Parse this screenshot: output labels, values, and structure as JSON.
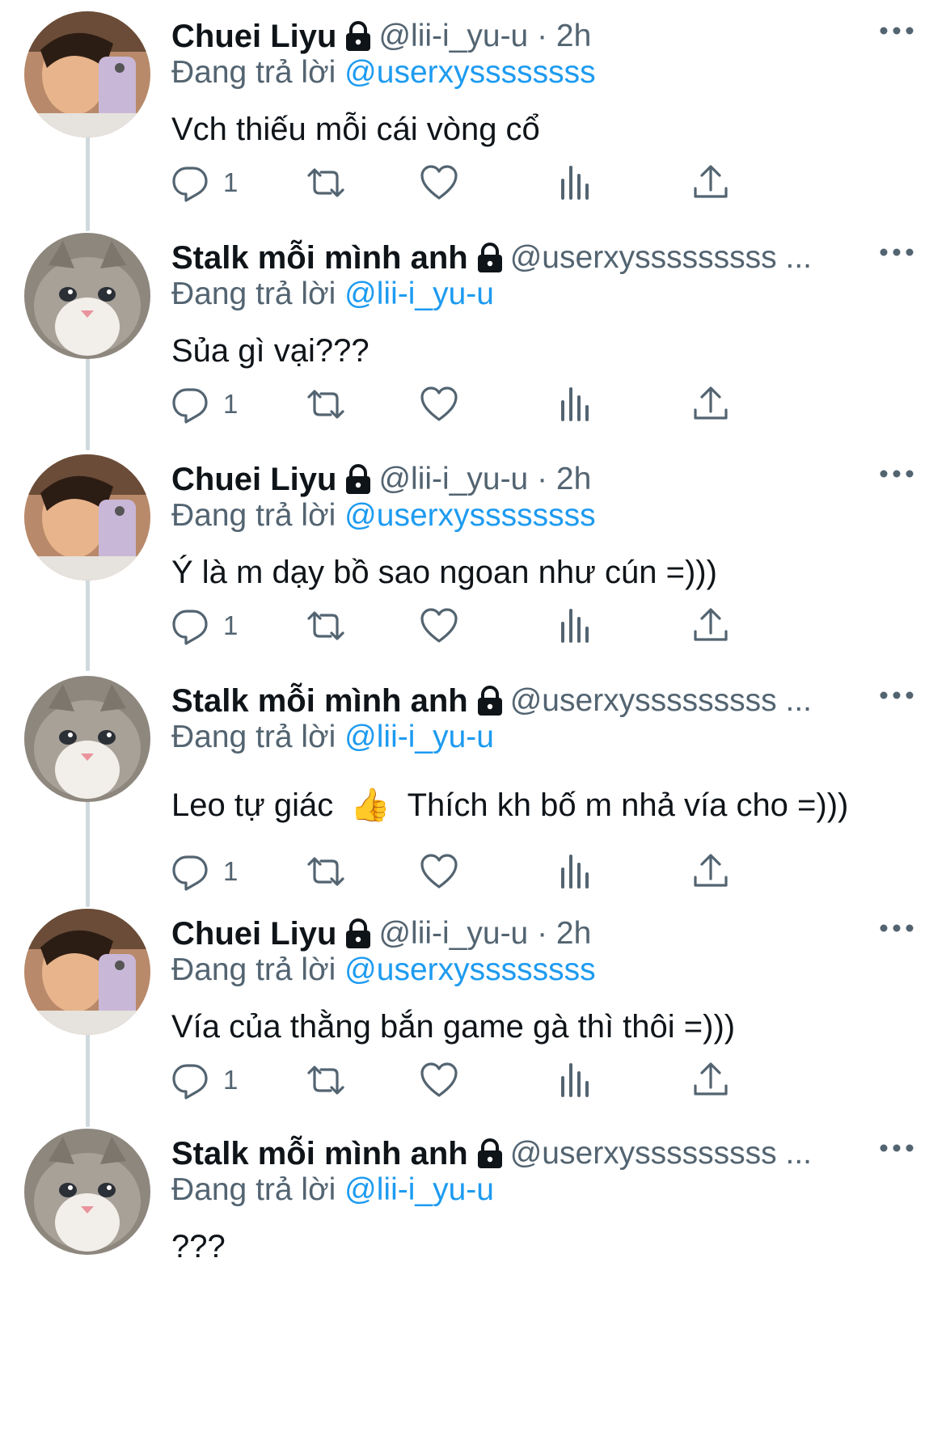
{
  "users": {
    "chuei": {
      "name": "Chuei Liyu",
      "handle_line": "@lii-i_yu-u · 2h",
      "avatar": "person-selfie-avatar"
    },
    "stalk": {
      "name": "Stalk mỗi mình anh",
      "handle_line": "@userxysssssssss ...",
      "avatar": "cat-avatar"
    }
  },
  "reply_prefix": "Đang trả lời",
  "tweets": [
    {
      "user": "Chuei Liyu",
      "handle_line": "@lii-i_yu-u · 2h",
      "reply_to": "@userxyssssssss",
      "text": "Vch thiếu mỗi cái vòng cổ",
      "reply_count": "1"
    },
    {
      "user": "Stalk mỗi mình anh",
      "handle_line": "@userxysssssssss ...",
      "reply_to": "@lii-i_yu-u",
      "text": "Sủa gì vại???",
      "reply_count": "1"
    },
    {
      "user": "Chuei Liyu",
      "handle_line": "@lii-i_yu-u · 2h",
      "reply_to": "@userxyssssssss",
      "text": "Ý là m dạy bồ sao ngoan như cún =)))",
      "reply_count": "1"
    },
    {
      "user": "Stalk mỗi mình anh",
      "handle_line": "@userxysssssssss ...",
      "reply_to": "@lii-i_yu-u",
      "text_before": "Leo tự giác",
      "emoji": "👍",
      "text_after": "Thích kh bố m nhả vía cho =)))",
      "reply_count": "1"
    },
    {
      "user": "Chuei Liyu",
      "handle_line": "@lii-i_yu-u · 2h",
      "reply_to": "@userxyssssssss",
      "text": "Vía của thằng bắn game gà thì thôi =)))",
      "reply_count": "1"
    },
    {
      "user": "Stalk mỗi mình anh",
      "handle_line": "@userxysssssssss ...",
      "reply_to": "@lii-i_yu-u",
      "text": "???"
    }
  ],
  "icons": [
    "reply-icon",
    "retweet-icon",
    "like-icon",
    "analytics-icon",
    "share-icon",
    "lock-icon",
    "more-icon"
  ],
  "colors": {
    "link": "#1d9bf0",
    "secondary": "#536471",
    "thread_line": "#cfd9de"
  }
}
